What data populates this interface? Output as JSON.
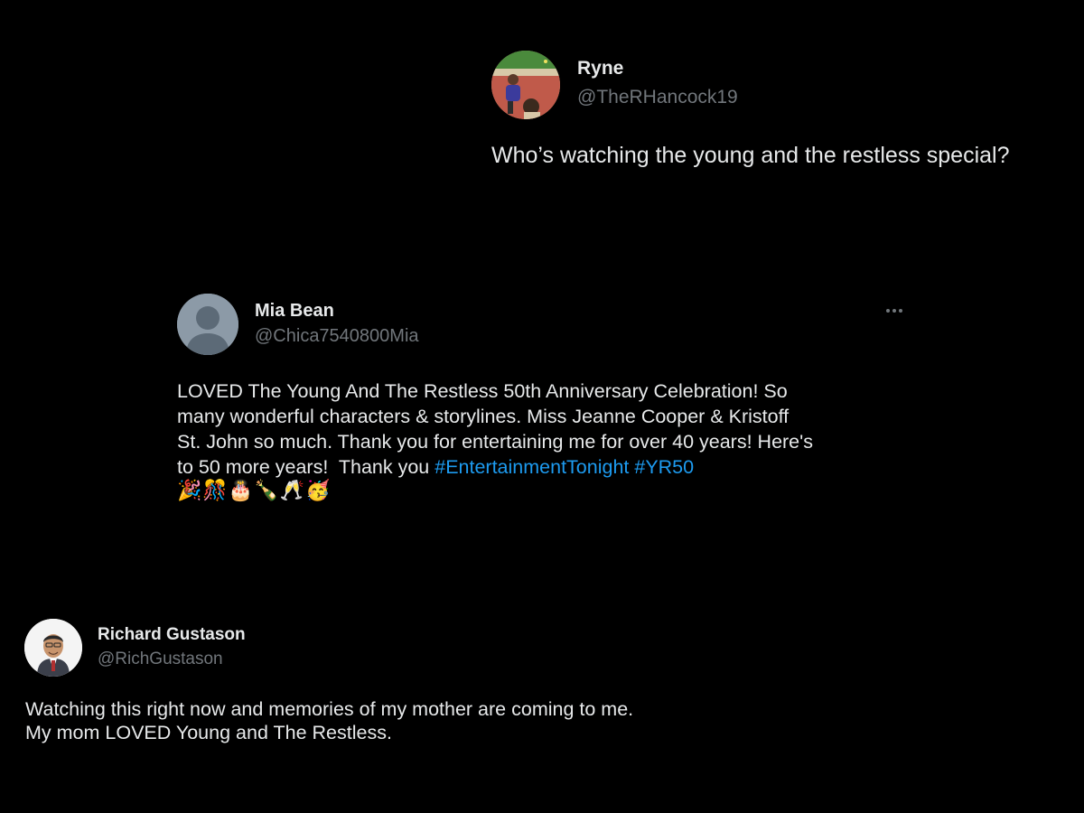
{
  "tweets": [
    {
      "name": "Ryne",
      "handle": "@TheRHancock19",
      "text": "Who’s watching the young and the restless special?"
    },
    {
      "name": "Mia Bean",
      "handle": "@Chica7540800Mia",
      "text_lines": [
        "LOVED The Young And The Restless 50th Anniversary Celebration! So",
        "many wonderful characters & storylines. Miss Jeanne Cooper & Kristoff",
        "St. John so much. Thank you for entertaining me for over 40 years! Here's",
        "to 50 more years!  Thank you "
      ],
      "hashtag_1": "#EntertainmentTonight",
      "hashtag_2": "#YR50",
      "emoji": "🎉🎊🎂🍾🥂🥳",
      "more_icon": "more-horizontal-icon"
    },
    {
      "name": "Richard Gustason",
      "handle": "@RichGustason",
      "text_lines": [
        "Watching this right now and memories of my mother are coming to me.",
        "My mom LOVED Young and The Restless."
      ]
    }
  ],
  "colors": {
    "background": "#000000",
    "text": "#e7e9ea",
    "secondary_text": "#71767b",
    "link": "#1d9bf0"
  }
}
